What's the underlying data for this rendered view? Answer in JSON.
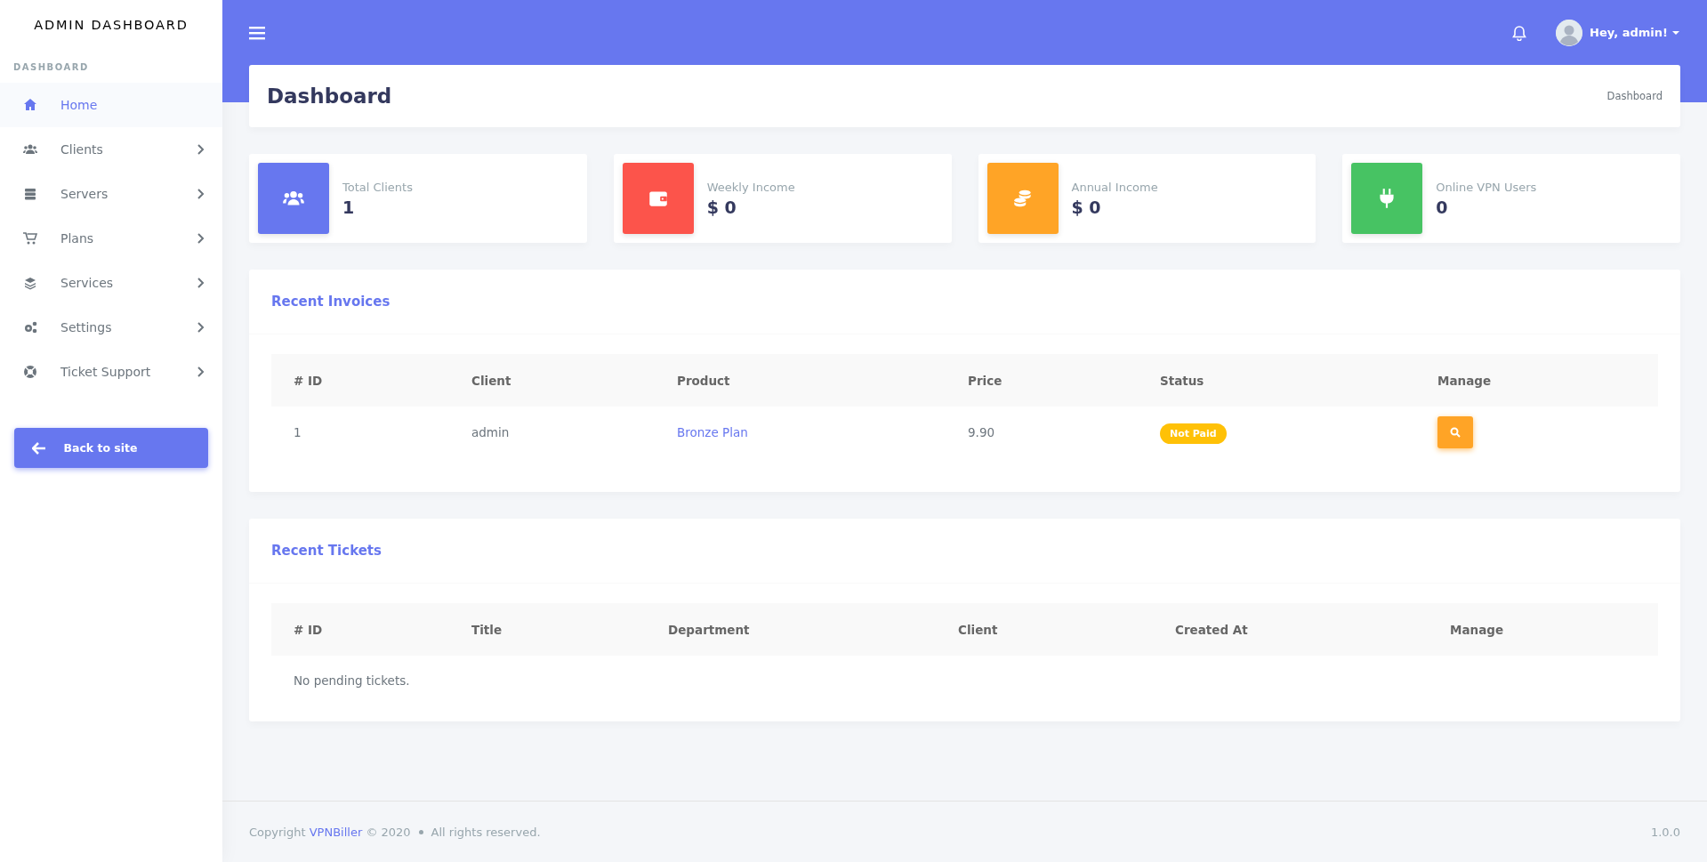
{
  "sidebar": {
    "title": "ADMIN DASHBOARD",
    "section": "DASHBOARD",
    "items": [
      {
        "label": "Home",
        "selected": true,
        "expandable": false
      },
      {
        "label": "Clients",
        "selected": false,
        "expandable": true
      },
      {
        "label": "Servers",
        "selected": false,
        "expandable": true
      },
      {
        "label": "Plans",
        "selected": false,
        "expandable": true
      },
      {
        "label": "Services",
        "selected": false,
        "expandable": true
      },
      {
        "label": "Settings",
        "selected": false,
        "expandable": true
      },
      {
        "label": "Ticket Support",
        "selected": false,
        "expandable": true
      }
    ],
    "back_button": "Back to site"
  },
  "topbar": {
    "user": "Hey, admin!"
  },
  "page_header": {
    "title": "Dashboard",
    "breadcrumb": "Dashboard"
  },
  "stats": [
    {
      "label": "Total Clients",
      "value": "1",
      "color": "#6777ef"
    },
    {
      "label": "Weekly Income",
      "value": "$ 0",
      "color": "#fc544b"
    },
    {
      "label": "Annual Income",
      "value": "$ 0",
      "color": "#ffa426"
    },
    {
      "label": "Online VPN Users",
      "value": "0",
      "color": "#47c363"
    }
  ],
  "invoices": {
    "title": "Recent Invoices",
    "columns": [
      "# ID",
      "Client",
      "Product",
      "Price",
      "Status",
      "Manage"
    ],
    "rows": [
      {
        "id": "1",
        "client": "admin",
        "product": "Bronze Plan",
        "price": "9.90",
        "status": "Not Paid"
      }
    ]
  },
  "tickets": {
    "title": "Recent Tickets",
    "columns": [
      "# ID",
      "Title",
      "Department",
      "Client",
      "Created At",
      "Manage"
    ],
    "empty": "No pending tickets."
  },
  "footer": {
    "prefix": "Copyright",
    "brand": "VPNBiller",
    "suffix": "© 2020",
    "rights": "All rights reserved.",
    "version": "1.0.0"
  }
}
